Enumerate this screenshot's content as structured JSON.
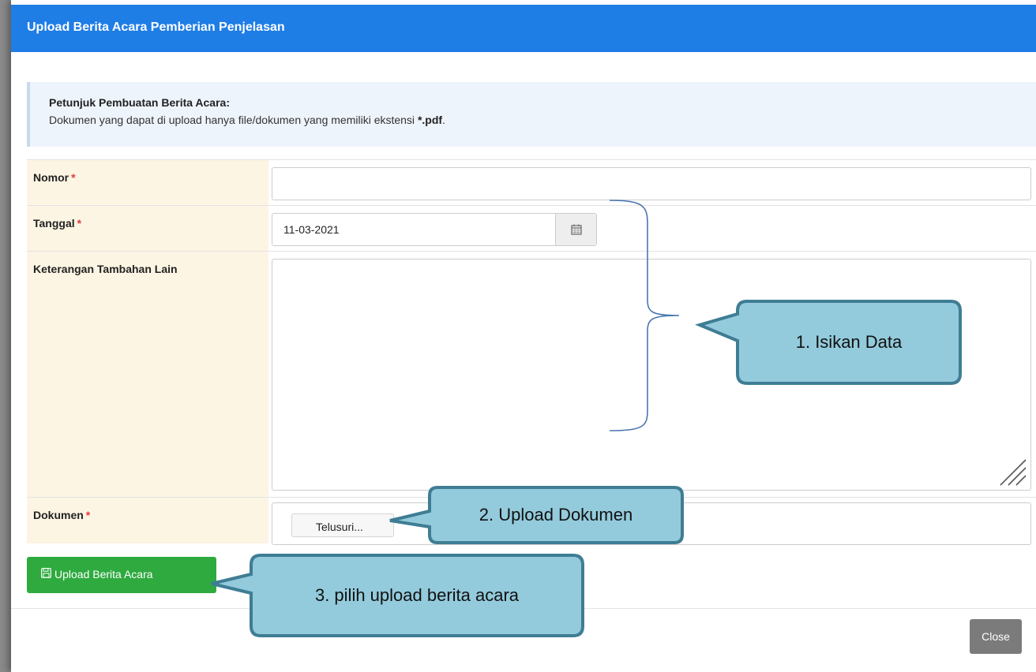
{
  "dialog": {
    "title": "Upload Berita Acara Pemberian Penjelasan",
    "info_title": "Petunjuk Pembuatan Berita Acara:",
    "info_text": "Dokumen yang dapat di upload hanya file/dokumen yang memiliki ekstensi ",
    "info_ext": "*.pdf",
    "info_end": "."
  },
  "form": {
    "nomor_label": "Nomor",
    "nomor_value": "",
    "tanggal_label": "Tanggal",
    "tanggal_value": "11-03-2021",
    "keterangan_label": "Keterangan Tambahan Lain",
    "keterangan_value": "",
    "dokumen_label": "Dokumen",
    "browse_label": "Telusuri...",
    "required_mark": "*"
  },
  "actions": {
    "upload_label": "Upload Berita Acara",
    "close_label": "Close"
  },
  "callouts": {
    "isi_data": "1.   Isikan Data",
    "upload_dokumen": "2. Upload Dokumen",
    "pilih_upload": "3. pilih upload berita acara"
  },
  "colors": {
    "header": "#1f7de6",
    "label_bg": "#fcf5e3",
    "upload_button": "#2eaa3f",
    "close_button": "#7b7b7b",
    "callout_fill": "#93cbdc",
    "callout_border": "#3f7d94",
    "bracket": "#4a76b0"
  },
  "icons": {
    "calendar": "calendar-icon",
    "save": "floppy-disk-icon",
    "resize": "resize-grip-icon"
  }
}
